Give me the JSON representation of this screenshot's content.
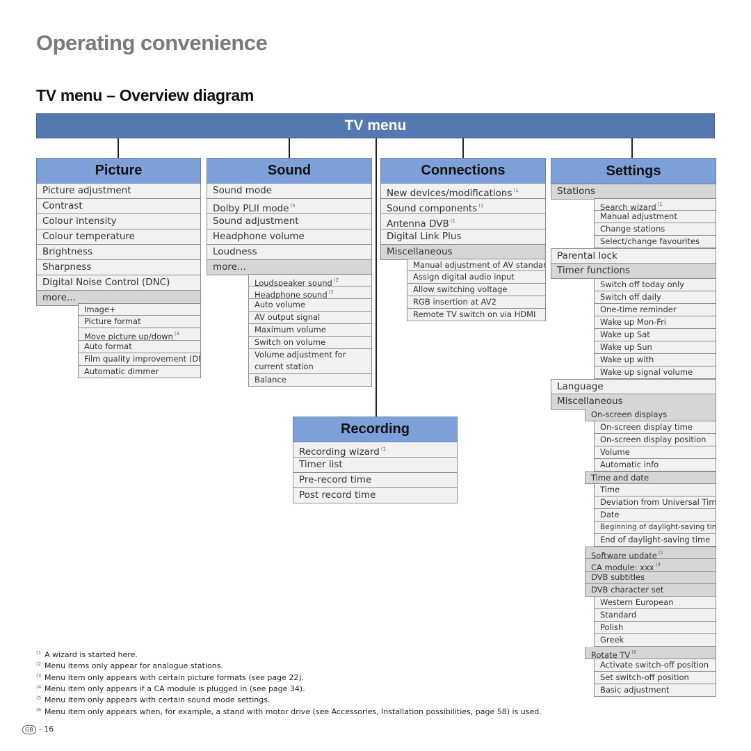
{
  "page": {
    "title": "Operating convenience",
    "subtitle": "TV menu – Overview diagram",
    "page_badge": "GB",
    "page_number": "- 16"
  },
  "root": {
    "label": "TV menu",
    "color": "#5478b0"
  },
  "colors": {
    "header": "#7ea0d8",
    "row": "#f1f1f1",
    "row_group": "#d6d6d6"
  },
  "picture": {
    "label": "Picture",
    "items": [
      "Picture adjustment",
      "Contrast",
      "Colour intensity",
      "Colour temperature",
      "Brightness",
      "Sharpness",
      "Digital Noise Control (DNC)"
    ],
    "more": "more...",
    "sub": [
      {
        "label": "Image+",
        "note": ""
      },
      {
        "label": "Picture format",
        "note": ""
      },
      {
        "label": "Move picture up/down",
        "note": "(3"
      },
      {
        "label": "Auto format",
        "note": ""
      },
      {
        "label": "Film quality improvement (DMM)",
        "note": ""
      },
      {
        "label": "Automatic dimmer",
        "note": ""
      }
    ]
  },
  "sound": {
    "label": "Sound",
    "items": [
      {
        "label": "Sound mode",
        "note": ""
      },
      {
        "label": "Dolby PLII mode",
        "note": "(5"
      },
      {
        "label": "Sound adjustment",
        "note": ""
      },
      {
        "label": "Headphone volume",
        "note": ""
      },
      {
        "label": "Loudness",
        "note": ""
      }
    ],
    "more": "more...",
    "sub": [
      {
        "label": "Loudspeaker sound",
        "note": "(2"
      },
      {
        "label": "Headphone sound",
        "note": "(2"
      },
      {
        "label": "Auto volume",
        "note": ""
      },
      {
        "label": "AV output signal",
        "note": ""
      },
      {
        "label": "Maximum volume",
        "note": ""
      },
      {
        "label": "Switch on volume",
        "note": ""
      },
      {
        "label": "Volume adjustment for current station",
        "note": ""
      },
      {
        "label": "Balance",
        "note": ""
      }
    ]
  },
  "connections": {
    "label": "Connections",
    "items": [
      {
        "label": "New devices/modifications",
        "note": "(1"
      },
      {
        "label": "Sound components",
        "note": "(1"
      },
      {
        "label": "Antenna DVB",
        "note": "(1"
      },
      {
        "label": "Digital Link Plus",
        "note": ""
      }
    ],
    "misc": "Miscellaneous",
    "sub": [
      "Manual adjustment of AV standard",
      "Assign digital audio input",
      "Allow switching voltage",
      "RGB insertion at AV2",
      "Remote TV switch on via HDMI"
    ]
  },
  "recording": {
    "label": "Recording",
    "items": [
      {
        "label": "Recording wizard",
        "note": "(1"
      },
      {
        "label": "Timer list",
        "note": ""
      },
      {
        "label": "Pre-record time",
        "note": ""
      },
      {
        "label": "Post record time",
        "note": ""
      }
    ]
  },
  "settings": {
    "label": "Settings",
    "stations": "Stations",
    "stations_sub": [
      {
        "label": "Search wizard",
        "note": "(1"
      },
      {
        "label": "Manual adjustment",
        "note": ""
      },
      {
        "label": "Change stations",
        "note": ""
      },
      {
        "label": "Select/change favourites",
        "note": ""
      }
    ],
    "parental_lock": "Parental lock",
    "timer": "Timer functions",
    "timer_sub": [
      "Switch off today only",
      "Switch off daily",
      "One-time reminder",
      "Wake up Mon-Fri",
      "Wake up Sat",
      "Wake up Sun",
      "Wake up with",
      "Wake up signal volume"
    ],
    "language": "Language",
    "misc": "Miscellaneous",
    "osd": "On-screen displays",
    "osd_sub": [
      "On-screen display time",
      "On-screen display position",
      "Volume",
      "Automatic info"
    ],
    "time_date": "Time and date",
    "time_sub": [
      "Time",
      "Deviation from Universal Time",
      "Date",
      "Beginning of daylight-saving time",
      "End of daylight-saving time"
    ],
    "software_update": {
      "label": "Software update",
      "note": "(1"
    },
    "ca_module": {
      "label": "CA module: xxx",
      "note": "(4"
    },
    "dvb_subtitles": "DVB subtitles",
    "dvb_charset": "DVB character set",
    "charset_sub": [
      "Western European",
      "Standard",
      "Polish",
      "Greek"
    ],
    "rotate": {
      "label": "Rotate TV",
      "note": "(6"
    },
    "rotate_sub": [
      "Activate switch-off position",
      "Set switch-off position",
      "Basic adjustment"
    ]
  },
  "footnotes": [
    {
      "num": "(1",
      "text": "A wizard is started here."
    },
    {
      "num": "(2",
      "text": "Menu items only appear for analogue stations."
    },
    {
      "num": "(3",
      "text": "Menu item only appears with certain picture formats (see page 22)."
    },
    {
      "num": "(4",
      "text": "Menu item only appears if a CA module is plugged in (see page 34)."
    },
    {
      "num": "(5",
      "text": "Menu item only appears with certain sound mode settings."
    },
    {
      "num": "(6",
      "text": "Menu item only appears when, for example, a stand with motor drive (see Accessories, Installation possibilities, page 58) is used."
    }
  ]
}
